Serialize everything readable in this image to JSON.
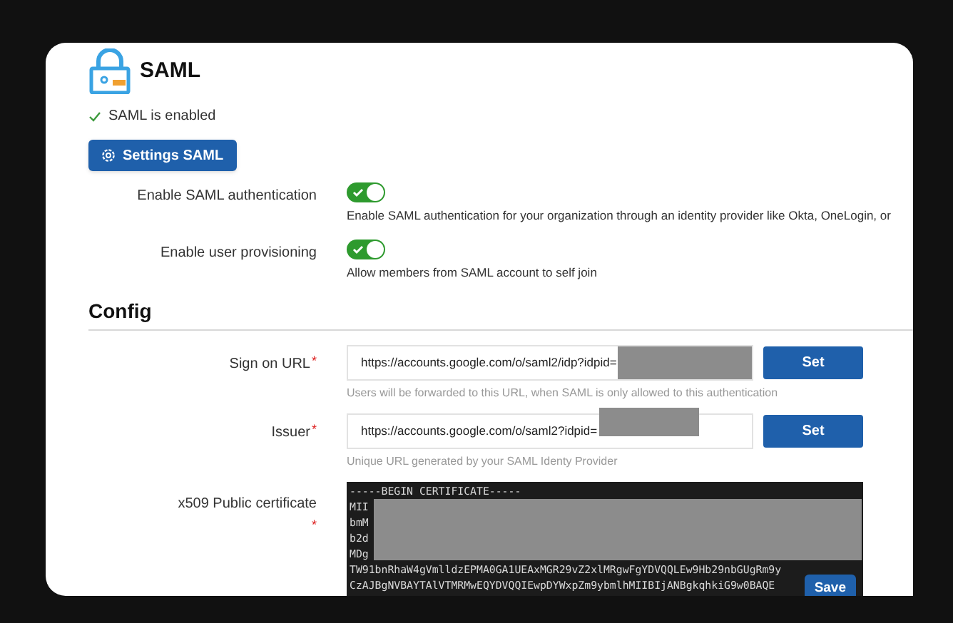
{
  "header": {
    "title": "SAML",
    "status": {
      "text": "SAML is enabled",
      "enabled": true
    },
    "settings_button": "Settings SAML"
  },
  "toggles": [
    {
      "label": "Enable SAML authentication",
      "on": true,
      "description": "Enable SAML authentication for your organization through an identity provider like Okta, OneLogin, or"
    },
    {
      "label": "Enable user provisioning",
      "on": true,
      "description": "Allow members from SAML account to self join"
    }
  ],
  "config": {
    "title": "Config",
    "fields": [
      {
        "label": "Sign on URL",
        "required_mark": "*",
        "value": "https://accounts.google.com/o/saml2/idp?idpid=",
        "button": "Set",
        "hint": "Users will be forwarded to this URL, when SAML is only allowed to this authentication"
      },
      {
        "label": "Issuer",
        "required_mark": "*",
        "value": "https://accounts.google.com/o/saml2?idpid=",
        "button": "Set",
        "hint": "Unique URL generated by your SAML Identy Provider"
      }
    ],
    "certificate": {
      "label": "x509 Public certificate",
      "required_mark": "*",
      "lines": [
        "-----BEGIN CERTIFICATE-----",
        "MII",
        "bmM",
        "b2d",
        "MDg",
        "TW91bnRhaW4gVmlldzEPMA0GA1UEAxMGR29vZ2xlMRgwFgYDVQQLEw9Hb29nbGUgRm9y",
        "CzAJBgNVBAYTAlVTMRMwEQYDVQQIEwpDYWxpZm9ybmlhMIIBIjANBgkqhkiG9w0BAQE"
      ]
    },
    "save_button": "Save"
  }
}
